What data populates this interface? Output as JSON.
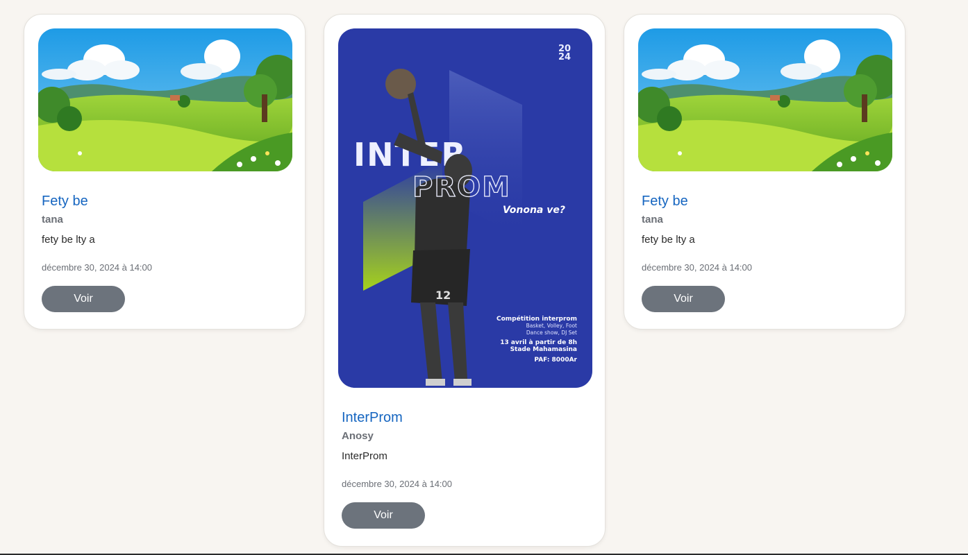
{
  "events": [
    {
      "title": "Fety be",
      "location": "tana",
      "description": "fety be lty a",
      "date": "décembre 30, 2024 à 14:00",
      "button_label": "Voir",
      "image": "landscape"
    },
    {
      "title": "InterProm",
      "location": "Anosy",
      "description": "InterProm",
      "date": "décembre 30, 2024 à 14:00",
      "button_label": "Voir",
      "image": "poster",
      "poster": {
        "year_top": "20",
        "year_bottom": "24",
        "line1": "INTER",
        "line2": "PROM",
        "tagline": "Vonona ve?",
        "jersey_number": "12",
        "info1": "Compétition interprom",
        "info2": "Basket, Volley, Foot",
        "info3": "Dance show, DJ Set",
        "info4": "13 avril à partir de 8h",
        "info5": "Stade Mahamasina",
        "info6": "PAF: 8000Ar"
      }
    },
    {
      "title": "Fety be",
      "location": "tana",
      "description": "fety be lty a",
      "date": "décembre 30, 2024 à 14:00",
      "button_label": "Voir",
      "image": "landscape"
    }
  ],
  "colors": {
    "background": "#f8f5f1",
    "title": "#1565c0",
    "button": "#6c737c",
    "poster_blue": "#2a3aa6",
    "poster_green": "#a6d21c"
  }
}
